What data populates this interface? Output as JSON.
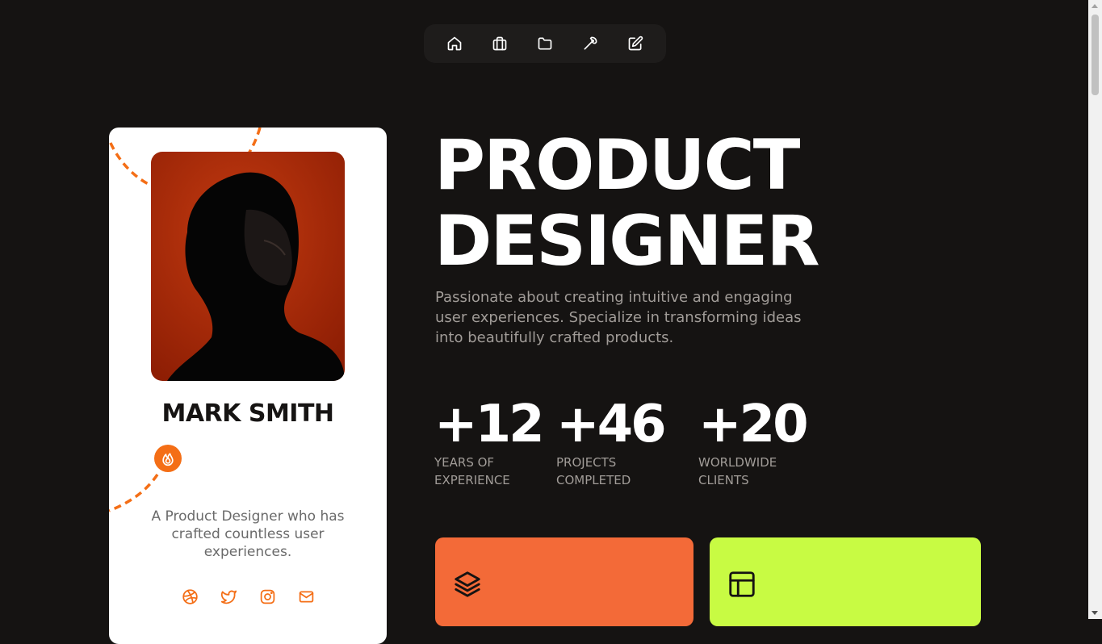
{
  "nav": {
    "items": [
      {
        "icon": "home-icon",
        "name": "Home"
      },
      {
        "icon": "briefcase-icon",
        "name": "Experience"
      },
      {
        "icon": "folder-icon",
        "name": "Projects"
      },
      {
        "icon": "wrench-icon",
        "name": "Tools"
      },
      {
        "icon": "edit-icon",
        "name": "Thoughts"
      }
    ]
  },
  "profile": {
    "name": "MARK SMITH",
    "bio": "A Product Designer who has crafted countless user experiences.",
    "badge_icon": "flame-icon",
    "socials": [
      "dribbble-icon",
      "twitter-icon",
      "instagram-icon",
      "mail-icon"
    ]
  },
  "hero": {
    "title_line1": "PRODUCT",
    "title_line2": "DESIGNER",
    "intro": "Passionate about creating intuitive and engaging user experiences. Specialize in transforming ideas into beautifully crafted products."
  },
  "stats": [
    {
      "value": "+12",
      "label_line1": "YEARS OF",
      "label_line2": "EXPERIENCE"
    },
    {
      "value": "+46",
      "label_line1": "PROJECTS",
      "label_line2": "COMPLETED"
    },
    {
      "value": "+20",
      "label_line1": "WORLDWIDE",
      "label_line2": "CLIENTS"
    }
  ],
  "features": [
    {
      "icon": "layers-icon",
      "color": "#f36a38"
    },
    {
      "icon": "layout-icon",
      "color": "#c8fb43"
    }
  ],
  "colors": {
    "background": "#151312",
    "accent": "#f46e16",
    "card": "#ffffff",
    "muted_text": "#a19c98"
  }
}
